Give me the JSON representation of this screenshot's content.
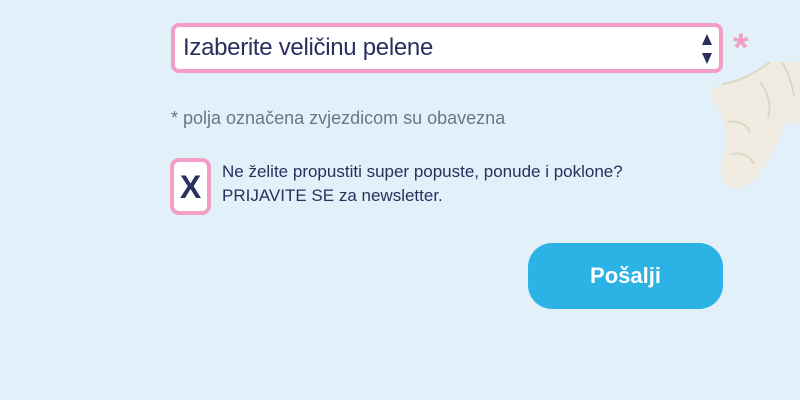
{
  "size_select": {
    "selected": "Izaberite veličinu pelene",
    "arrow_icon": "up-down-arrows-icon"
  },
  "required_marker": "*",
  "required_note": "* polja označena zvjezdicom su obavezna",
  "newsletter": {
    "checkbox_mark": "X",
    "line1": "Ne želite propustiti super popuste, ponude i poklone?",
    "line2": "PRIJAVITE SE za newsletter."
  },
  "submit_label": "Pošalji",
  "colors": {
    "background": "#e1f0f9",
    "accent_pink": "#f39ec4",
    "button_blue": "#2bb3e6",
    "text_navy": "#2b2f5e"
  }
}
